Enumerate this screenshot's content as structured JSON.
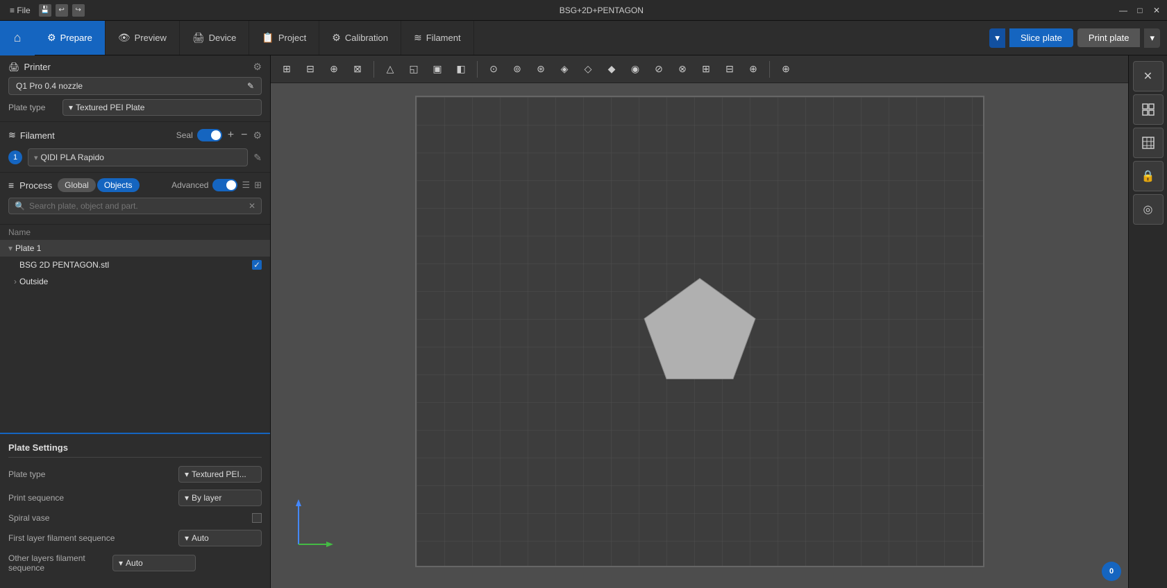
{
  "window": {
    "title": "BSG+2D+PENTAGON"
  },
  "titlebar": {
    "menu": "≡ File",
    "dropdown_arrow": "▾",
    "minimize": "—",
    "maximize": "□",
    "close": "✕"
  },
  "nav": {
    "home_icon": "⌂",
    "tabs": [
      {
        "id": "prepare",
        "label": "Prepare",
        "icon": "⚙",
        "active": true
      },
      {
        "id": "preview",
        "label": "Preview",
        "icon": "👁",
        "active": false
      },
      {
        "id": "device",
        "label": "Device",
        "icon": "🖨",
        "active": false
      },
      {
        "id": "project",
        "label": "Project",
        "icon": "📋",
        "active": false
      },
      {
        "id": "calibration",
        "label": "Calibration",
        "icon": "⚙",
        "active": false
      },
      {
        "id": "filament",
        "label": "Filament",
        "icon": "⚙",
        "active": false
      }
    ],
    "slice_label": "Slice plate",
    "print_label": "Print plate",
    "dropdown_arrow": "▾"
  },
  "printer": {
    "section_title": "Printer",
    "printer_name": "Q1 Pro 0.4 nozzle",
    "plate_type_label": "Plate type",
    "plate_type_value": "Textured PEI Plate"
  },
  "filament": {
    "section_title": "Filament",
    "seal_label": "Seal",
    "filament_name": "QIDI PLA Rapido",
    "filament_number": "1"
  },
  "process": {
    "section_title": "Process",
    "tab_global": "Global",
    "tab_objects": "Objects",
    "advanced_label": "Advanced",
    "search_placeholder": "Search plate, object and part."
  },
  "tree": {
    "name_header": "Name",
    "plate_name": "Plate 1",
    "file_name": "BSG 2D PENTAGON.stl",
    "outside_label": "Outside"
  },
  "plate_settings": {
    "title": "Plate Settings",
    "plate_type_label": "Plate type",
    "plate_type_value": "Textured PEI...",
    "print_sequence_label": "Print sequence",
    "print_sequence_value": "By layer",
    "spiral_vase_label": "Spiral vase",
    "first_layer_label": "First layer filament sequence",
    "first_layer_value": "Auto",
    "other_layers_label": "Other layers filament sequence",
    "other_layers_value": "Auto"
  },
  "viewport_tools": [
    "⊞",
    "⊟",
    "⊕",
    "⊠",
    "△",
    "◱",
    "▣",
    "◧",
    "⊙",
    "⊚",
    "⊛",
    "◈",
    "◇",
    "◆",
    "◉",
    "⊘",
    "⊗",
    "⊞",
    "⊟",
    "⊕",
    "⊠"
  ],
  "right_panel": {
    "buttons": [
      "✕",
      "⊡",
      "⊞",
      "🔒",
      "◎"
    ]
  },
  "version": "0"
}
